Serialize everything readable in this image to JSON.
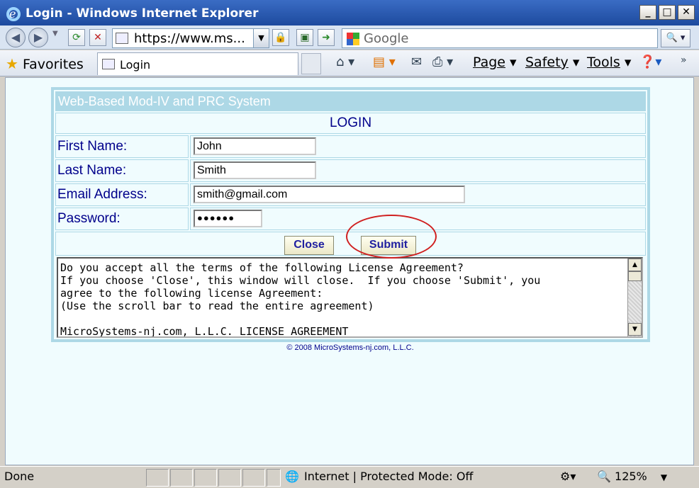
{
  "window": {
    "title": "Login - Windows Internet Explorer"
  },
  "nav": {
    "address": "https://www.ms...",
    "search_placeholder": "Google"
  },
  "favbar": {
    "favorites_label": "Favorites",
    "tab_label": "Login",
    "commands": [
      {
        "label": "Page"
      },
      {
        "label": "Safety"
      },
      {
        "label": "Tools"
      }
    ]
  },
  "form": {
    "header": "Web-Based Mod-IV and PRC System",
    "title": "LOGIN",
    "fields": {
      "first_name": {
        "label": "First Name:",
        "value": "John"
      },
      "last_name": {
        "label": "Last Name:",
        "value": "Smith"
      },
      "email": {
        "label": "Email Address:",
        "value": "smith@gmail.com"
      },
      "password": {
        "label": "Password:",
        "value": "●●●●●●"
      }
    },
    "close_label": "Close",
    "submit_label": "Submit",
    "license_text": "Do you accept all the terms of the following License Agreement?\nIf you choose 'Close', this window will close.  If you choose 'Submit', you\nagree to the following license Agreement:\n(Use the scroll bar to read the entire agreement)\n\nMicroSystems-nj.com, L.L.C. LICENSE AGREEMENT",
    "copyright": "© 2008 MicroSystems-nj.com, L.L.C."
  },
  "status": {
    "left_text": "Done",
    "zone_text": "Internet | Protected Mode: Off",
    "zoom": "125%"
  },
  "colors": {
    "accent": "#add8e6",
    "label_text": "#00008b",
    "annotation": "#d02020"
  }
}
